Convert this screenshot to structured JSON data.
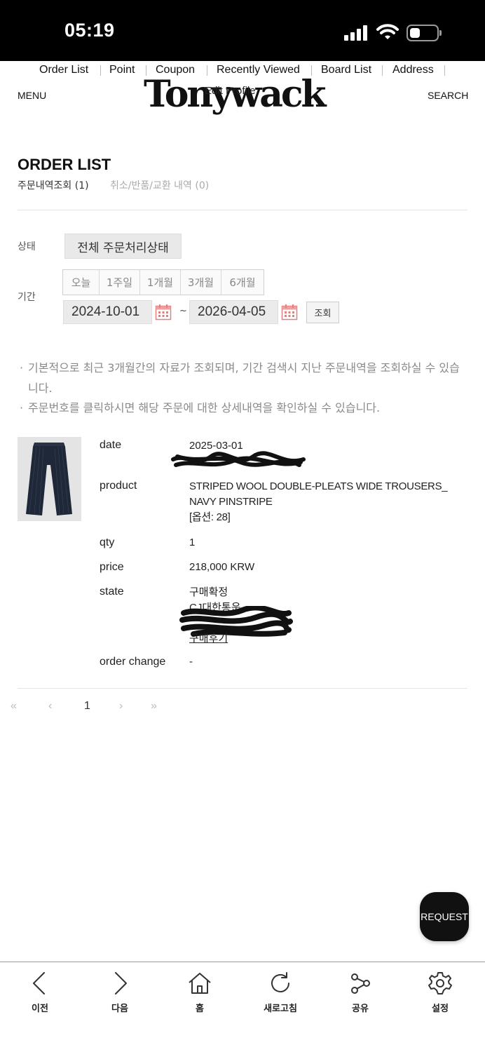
{
  "status_bar": {
    "time": "05:19"
  },
  "top_nav": [
    "Order List",
    "Point",
    "Coupon",
    "Recently Viewed",
    "Board List",
    "Address"
  ],
  "header": {
    "menu": "MENU",
    "logo": "Tonywack",
    "edit_profile": "Edit Profile",
    "search": "SEARCH"
  },
  "page": {
    "title": "ORDER LIST",
    "tabs": [
      {
        "label": "주문내역조회 (1)"
      },
      {
        "label": "취소/반품/교환 내역 (0)"
      }
    ]
  },
  "filters": {
    "status_label": "상태",
    "status_value": "전체 주문처리상태",
    "period_label": "기간",
    "ranges": [
      "오늘",
      "1주일",
      "1개월",
      "3개월",
      "6개월"
    ],
    "start_date": "2024-10-01",
    "tilde": "~",
    "end_date": "2026-04-05",
    "search_button": "조회"
  },
  "notices": [
    "기본적으로 최근 3개월간의 자료가 조회되며, 기간 검색시 지난 주문내역을 조회하실 수 있습니다.",
    "주문번호를 클릭하시면 해당 주문에 대한 상세내역을 확인하실 수 있습니다."
  ],
  "notice_bullet": "·",
  "order": {
    "labels": {
      "date": "date",
      "product": "product",
      "qty": "qty",
      "price": "price",
      "state": "state",
      "change": "order change"
    },
    "date": "2025-03-01",
    "product_line1": "STRIPED WOOL DOUBLE-PLEATS WIDE TROUSERS_",
    "product_line2": "NAVY PINSTRIPE",
    "option": "[옵션: 28]",
    "qty": "1",
    "price": "218,000 KRW",
    "state": "구매확정",
    "carrier": "CJ대한통운",
    "review": "구매후기",
    "change": "-"
  },
  "pagination": {
    "first": "«",
    "prev": "‹",
    "page": "1",
    "next": "›",
    "last": "»"
  },
  "fab": {
    "label": "REQUEST"
  },
  "bottom_bar": [
    "이전",
    "다음",
    "홈",
    "새로고침",
    "공유",
    "설정"
  ]
}
